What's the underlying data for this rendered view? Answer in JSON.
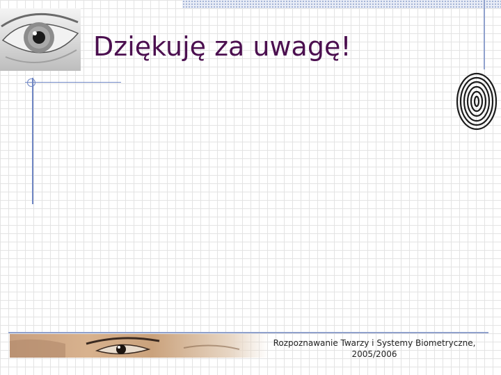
{
  "slide": {
    "title": "Dziękuję za uwagę!",
    "footer_line1": "Rozpoznawanie Twarzy i Systemy Biometryczne,",
    "footer_line2": "2005/2006"
  },
  "colors": {
    "title": "#4b0f4f",
    "accent_lines": "#6f86c4",
    "grid": "#e3e3e3"
  },
  "images": {
    "top_left": "eye-photo",
    "top_right": "fingerprint-image",
    "bottom": "face-photo"
  }
}
